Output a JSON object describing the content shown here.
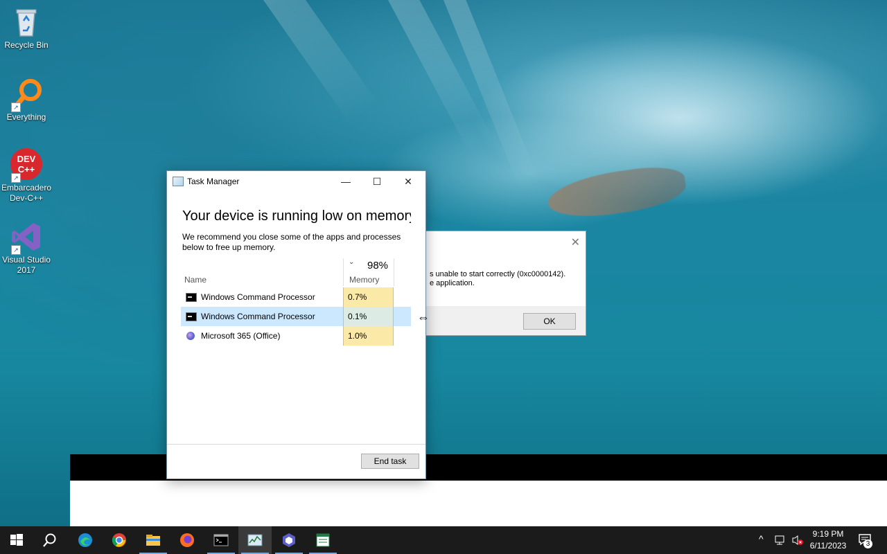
{
  "desktop": {
    "icons": [
      {
        "label": "Recycle Bin"
      },
      {
        "label": "Everything"
      },
      {
        "label": "Embarcadero Dev-C++",
        "glyph_text": "DEV C++"
      },
      {
        "label": "Visual Studio 2017"
      }
    ]
  },
  "error_dialog": {
    "message_line1": "s unable to start correctly (0xc0000142).",
    "message_line2": "e application.",
    "ok_label": "OK"
  },
  "task_manager": {
    "title": "Task Manager",
    "heading": "Your device is running low on memory",
    "description": "We recommend you close some of the apps and processes below to free up memory.",
    "memory_total": "98%",
    "columns": {
      "name": "Name",
      "memory": "Memory"
    },
    "processes": [
      {
        "name": "Windows Command Processor",
        "memory": "0.7%",
        "icon": "cmd-icon",
        "selected": false
      },
      {
        "name": "Windows Command Processor",
        "memory": "0.1%",
        "icon": "cmd-icon",
        "selected": true
      },
      {
        "name": "Microsoft 365 (Office)",
        "memory": "1.0%",
        "icon": "office-icon",
        "selected": false
      }
    ],
    "end_task_label": "End task"
  },
  "taskbar": {
    "apps": [
      "start-icon",
      "search-icon",
      "edge-icon",
      "chrome-icon",
      "file-explorer-icon",
      "firefox-icon",
      "cmd-icon",
      "task-manager-icon",
      "visual-studio-icon",
      "notepad-icon"
    ],
    "clock_time": "9:19 PM",
    "clock_date": "6/11/2023",
    "notification_count": "3"
  },
  "colors": {
    "accent": "#0078d4",
    "memory_highlight": "#fbe9a8",
    "selection": "#cce8ff"
  }
}
